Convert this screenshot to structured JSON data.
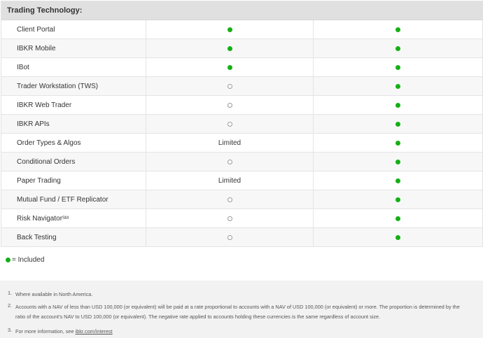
{
  "section_title": "Trading Technology:",
  "rows": [
    {
      "label": "Client Portal",
      "col1": "dot",
      "col2": "dot"
    },
    {
      "label": "IBKR Mobile",
      "col1": "dot",
      "col2": "dot"
    },
    {
      "label": "IBot",
      "col1": "dot",
      "col2": "dot"
    },
    {
      "label": "Trader Workstation (TWS)",
      "col1": "ring",
      "col2": "dot"
    },
    {
      "label": "IBKR Web Trader",
      "col1": "ring",
      "col2": "dot"
    },
    {
      "label": "IBKR APIs",
      "col1": "ring",
      "col2": "dot"
    },
    {
      "label": "Order Types & Algos",
      "col1": "Limited",
      "col2": "dot"
    },
    {
      "label": "Conditional Orders",
      "col1": "ring",
      "col2": "dot"
    },
    {
      "label": "Paper Trading",
      "col1": "Limited",
      "col2": "dot"
    },
    {
      "label": "Mutual Fund / ETF Replicator",
      "col1": "ring",
      "col2": "dot"
    },
    {
      "label": "Risk Navigator",
      "sup": "SM",
      "col1": "ring",
      "col2": "dot"
    },
    {
      "label": "Back Testing",
      "col1": "ring",
      "col2": "dot"
    }
  ],
  "legend": {
    "text": "= Included",
    "color": "#14b014"
  },
  "footnotes": [
    {
      "num": "1.",
      "text": "Where available in North America."
    },
    {
      "num": "2.",
      "text": "Accounts with a NAV of less than USD 100,000 (or equivalent) will be paid at a rate proportional to accounts with a NAV of USD 100,000 (or equivalent) or more. The proportion is determined by the ratio of the account's NAV to USD 100,000 (or equivalent). The negative rate applied to accounts holding these currencies is the same regardless of account size."
    },
    {
      "num": "3.",
      "text": "For more information, see ",
      "link": "ibkr.com/interest"
    }
  ]
}
